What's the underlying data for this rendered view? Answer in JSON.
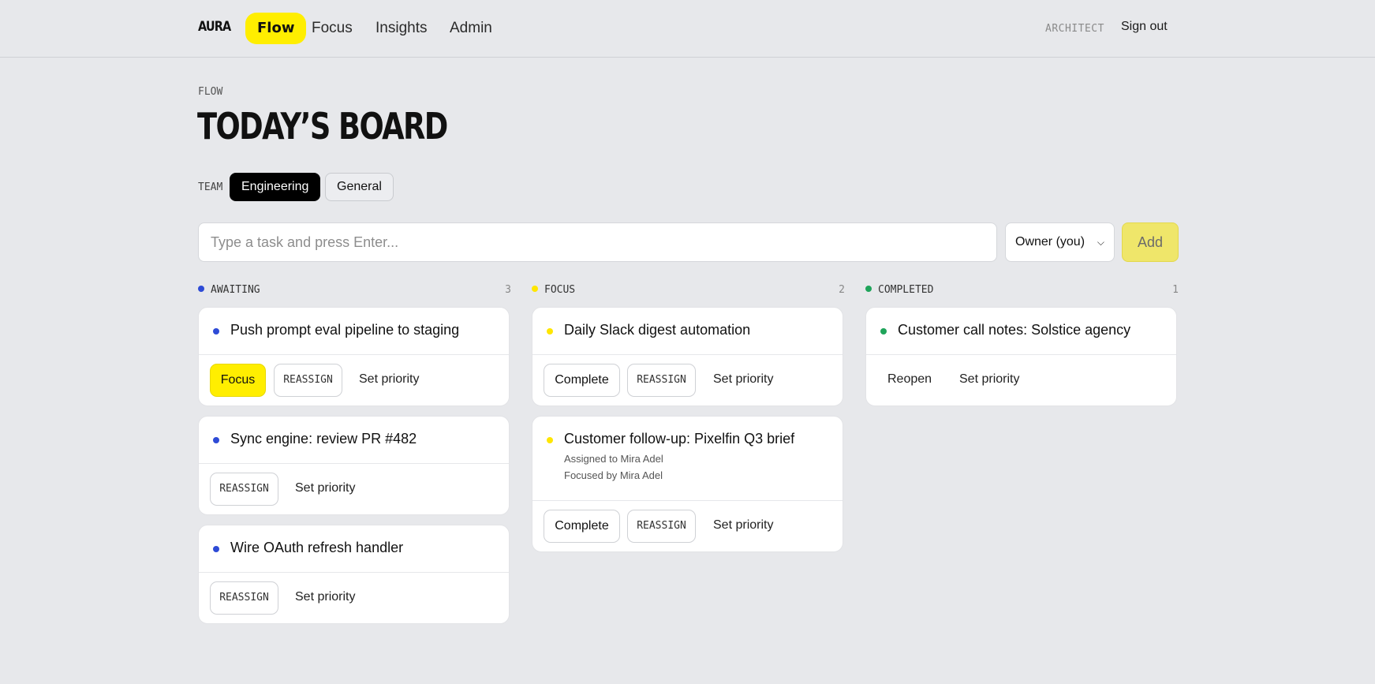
{
  "app": {
    "logo": "AURA"
  },
  "nav": {
    "items": [
      {
        "label": "Flow",
        "active": true
      },
      {
        "label": "Focus",
        "active": false
      },
      {
        "label": "Insights",
        "active": false
      },
      {
        "label": "Admin",
        "active": false
      }
    ],
    "role": "ARCHITECT",
    "sign_out": "Sign out"
  },
  "page": {
    "eyebrow": "FLOW",
    "title": "TODAY’S BOARD"
  },
  "team": {
    "label": "TEAM",
    "options": [
      {
        "label": "Engineering",
        "active": true
      },
      {
        "label": "General",
        "active": false
      }
    ]
  },
  "composer": {
    "placeholder": "Type a task and press Enter...",
    "value": "",
    "owner_selected": "Owner (you)",
    "add_label": "Add"
  },
  "colors": {
    "awaiting": "#2e4bd6",
    "focus": "#ffe600",
    "completed": "#1fa45a",
    "accent": "#ffee00"
  },
  "columns": [
    {
      "name": "AWAITING",
      "count": "3",
      "cards": [
        {
          "title": "Push prompt eval pipeline to staging",
          "actions": {
            "focus": "Focus",
            "reassign": "REASSIGN",
            "priority": "Set priority"
          }
        },
        {
          "title": "Sync engine: review PR #482",
          "actions": {
            "reassign": "REASSIGN",
            "priority": "Set priority"
          }
        },
        {
          "title": "Wire OAuth refresh handler",
          "actions": {
            "reassign": "REASSIGN",
            "priority": "Set priority"
          }
        }
      ]
    },
    {
      "name": "FOCUS",
      "count": "2",
      "cards": [
        {
          "title": "Daily Slack digest automation",
          "actions": {
            "complete": "Complete",
            "reassign": "REASSIGN",
            "priority": "Set priority"
          }
        },
        {
          "title": "Customer follow-up: Pixelfin Q3 brief",
          "meta": [
            "Assigned to Mira Adel",
            "Focused by Mira Adel"
          ],
          "actions": {
            "complete": "Complete",
            "reassign": "REASSIGN",
            "priority": "Set priority"
          }
        }
      ]
    },
    {
      "name": "COMPLETED",
      "count": "1",
      "cards": [
        {
          "title": "Customer call notes: Solstice agency",
          "actions": {
            "reopen": "Reopen",
            "priority": "Set priority"
          }
        }
      ]
    }
  ]
}
